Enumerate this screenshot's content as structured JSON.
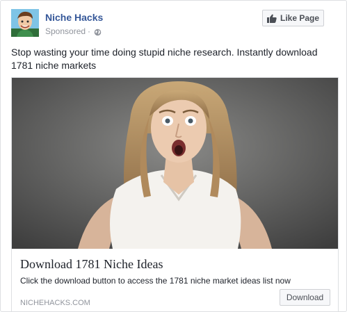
{
  "post": {
    "page_name": "Niche Hacks",
    "sponsored_label": "Sponsored",
    "separator": "·",
    "like_button_label": "Like Page",
    "message": "Stop wasting your time doing stupid niche research. Instantly download 1781 niche markets"
  },
  "link_preview": {
    "title": "Download 1781 Niche Ideas",
    "description": "Click the download button to access the 1781 niche market ideas list now",
    "domain": "NICHEHACKS.COM",
    "cta_label": "Download"
  },
  "icons": {
    "globe": "globe-icon",
    "like": "thumbs-up-icon"
  },
  "colors": {
    "page_name": "#365899",
    "meta_text": "#90949c",
    "body_text": "#1d2129",
    "button_bg": "#f6f7f9",
    "border": "#dddfe2"
  }
}
